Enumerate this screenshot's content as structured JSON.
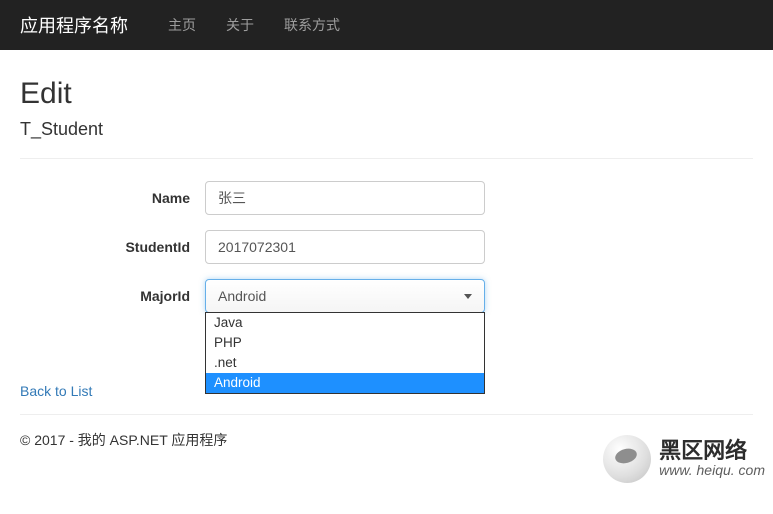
{
  "navbar": {
    "brand": "应用程序名称",
    "items": [
      "主页",
      "关于",
      "联系方式"
    ]
  },
  "page": {
    "title": "Edit",
    "subtitle": "T_Student"
  },
  "form": {
    "name": {
      "label": "Name",
      "value": "张三"
    },
    "studentId": {
      "label": "StudentId",
      "value": "2017072301"
    },
    "majorId": {
      "label": "MajorId",
      "selected": "Android",
      "options": [
        "Java",
        "PHP",
        ".net",
        "Android"
      ]
    }
  },
  "links": {
    "back": "Back to List"
  },
  "footer": {
    "text": "© 2017 - 我的 ASP.NET 应用程序"
  },
  "watermark": {
    "line1": "黑区网络",
    "line2": "www. heiqu. com"
  }
}
